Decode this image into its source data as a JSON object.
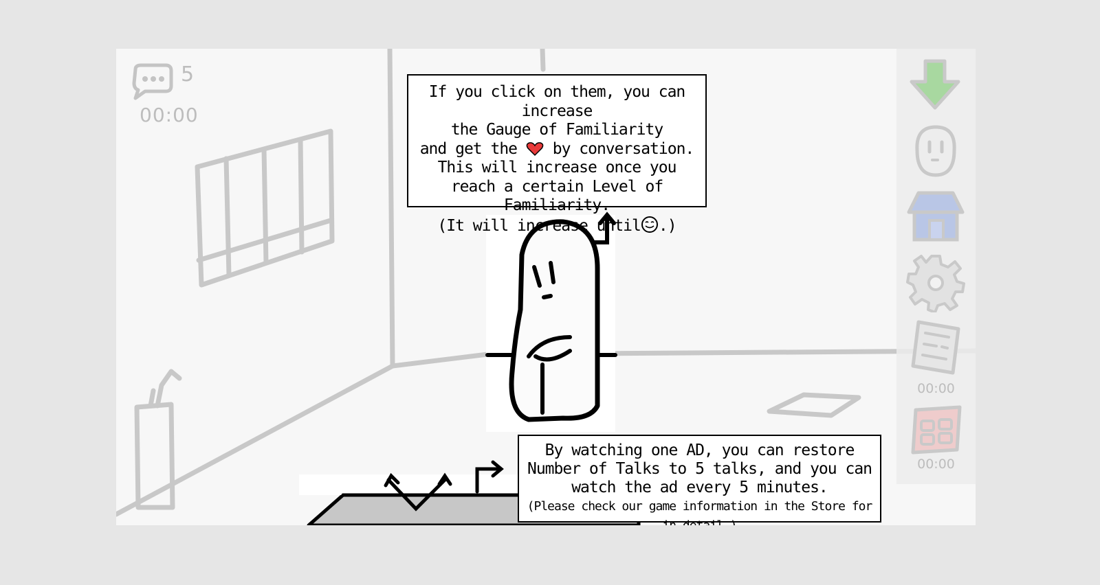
{
  "hud": {
    "talk_count": "5",
    "talk_timer": "00:00"
  },
  "sidebar": {
    "items": [
      {
        "name": "download-arrow",
        "icon": "down-arrow-icon",
        "color": "#a8d8a0"
      },
      {
        "name": "character",
        "icon": "ghost-face-icon",
        "color": "#e0e0e0"
      },
      {
        "name": "store",
        "icon": "house-icon",
        "color": "#b9c6e6"
      },
      {
        "name": "settings",
        "icon": "gear-icon",
        "color": "#dcdcdc"
      },
      {
        "name": "newspaper",
        "icon": "newspaper-icon",
        "color": "#e0e0e0",
        "timer": "00:00"
      },
      {
        "name": "calendar",
        "icon": "calendar-icon",
        "color": "#efcccc",
        "timer": "00:00"
      }
    ]
  },
  "tip_familiarity": {
    "line1": "If you click on them, you can increase",
    "line2": "the Gauge of Familiarity",
    "line3_before": "and get the ",
    "line3_after": " by conversation.",
    "line4": "This will increase once you",
    "line5": "reach a certain Level of Familiarity.",
    "line6_before": "(It will increase until",
    "line6_after": ".)"
  },
  "tip_ad": {
    "line1": "By watching one AD, you can restore",
    "line2": "Number of Talks to 5 talks, and you can",
    "line3": "watch the ad every 5 minutes.",
    "line4": "(Please check our game information in the Store for in detail.)"
  },
  "colors": {
    "heart": "#e83a3a",
    "background": "#e6e6e6",
    "scene": "#f7f7f7"
  }
}
